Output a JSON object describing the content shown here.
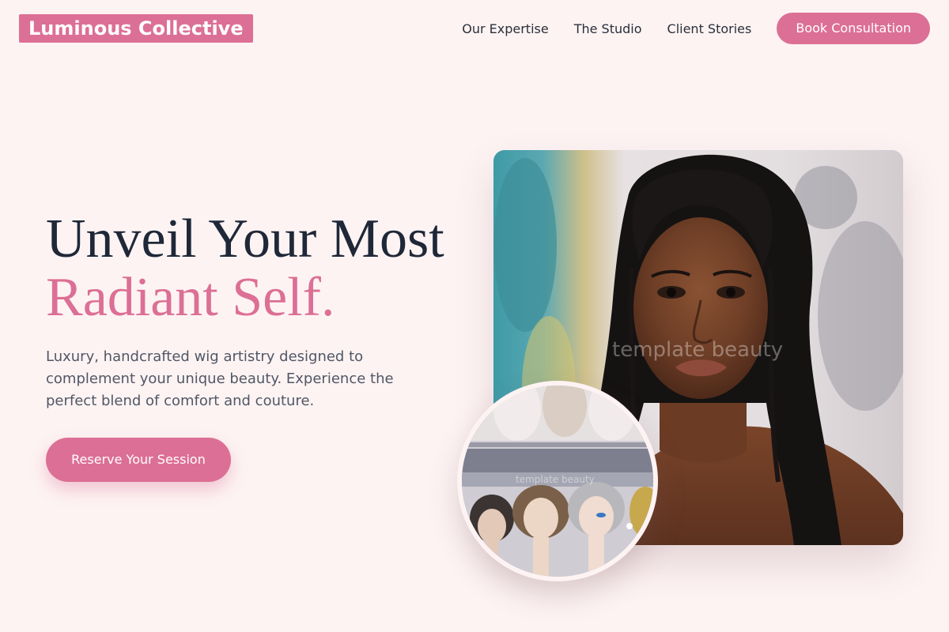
{
  "header": {
    "logo": "Luminous Collective",
    "nav": [
      {
        "label": "Our Expertise"
      },
      {
        "label": "The Studio"
      },
      {
        "label": "Client Stories"
      }
    ],
    "cta_label": "Book Consultation"
  },
  "hero": {
    "headline_line1": "Unveil Your Most",
    "headline_line2": "Radiant Self.",
    "subtext": "Luxury, handcrafted wig artistry designed to complement your unique beauty. Experience the perfect blend of comfort and couture.",
    "cta_label": "Reserve Your Session"
  },
  "images": {
    "main_watermark": "template beauty",
    "circle_watermark": "template beauty"
  },
  "colors": {
    "accent": "#dc6f95",
    "background": "#fdf3f3",
    "heading": "#1f2838",
    "body_text": "#515765"
  }
}
